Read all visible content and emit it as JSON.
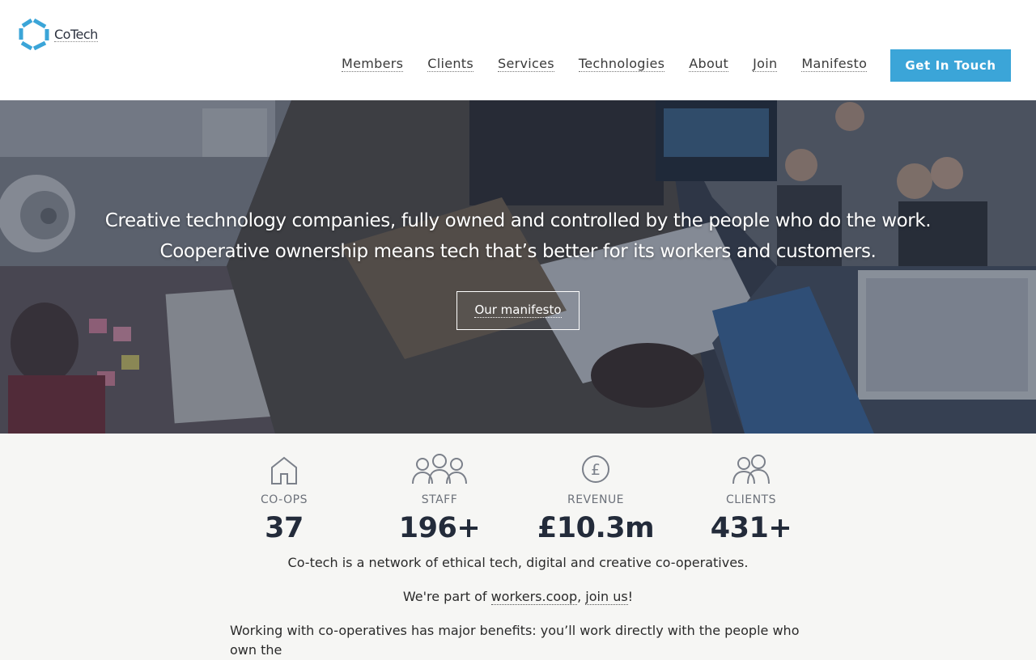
{
  "brand": {
    "name": "CoTech",
    "accent": "#3ba5d8"
  },
  "nav": {
    "items": [
      "Members",
      "Clients",
      "Services",
      "Technologies",
      "About",
      "Join",
      "Manifesto"
    ],
    "cta_label": "Get In Touch"
  },
  "hero": {
    "line1": "Creative technology companies, fully owned and controlled by the people who do the work.",
    "line2": "Cooperative ownership means tech that’s better for its workers and customers.",
    "button_label": "Our manifesto"
  },
  "stats": [
    {
      "icon": "house-icon",
      "label": "CO-OPS",
      "value": "37"
    },
    {
      "icon": "people-icon",
      "label": "STAFF",
      "value": "196+"
    },
    {
      "icon": "pound-icon",
      "label": "REVENUE",
      "value": "£10.3m"
    },
    {
      "icon": "pair-icon",
      "label": "CLIENTS",
      "value": "431+"
    }
  ],
  "intro": {
    "text": "Co-tech is a network of ethical tech, digital and creative co-operatives.",
    "prefix": "We're part of ",
    "link1": "workers.coop",
    "sep": ", ",
    "link2": "join us",
    "suffix": "!",
    "benefits": "Working with co-operatives has major benefits: you’ll work directly with the people who own the"
  }
}
